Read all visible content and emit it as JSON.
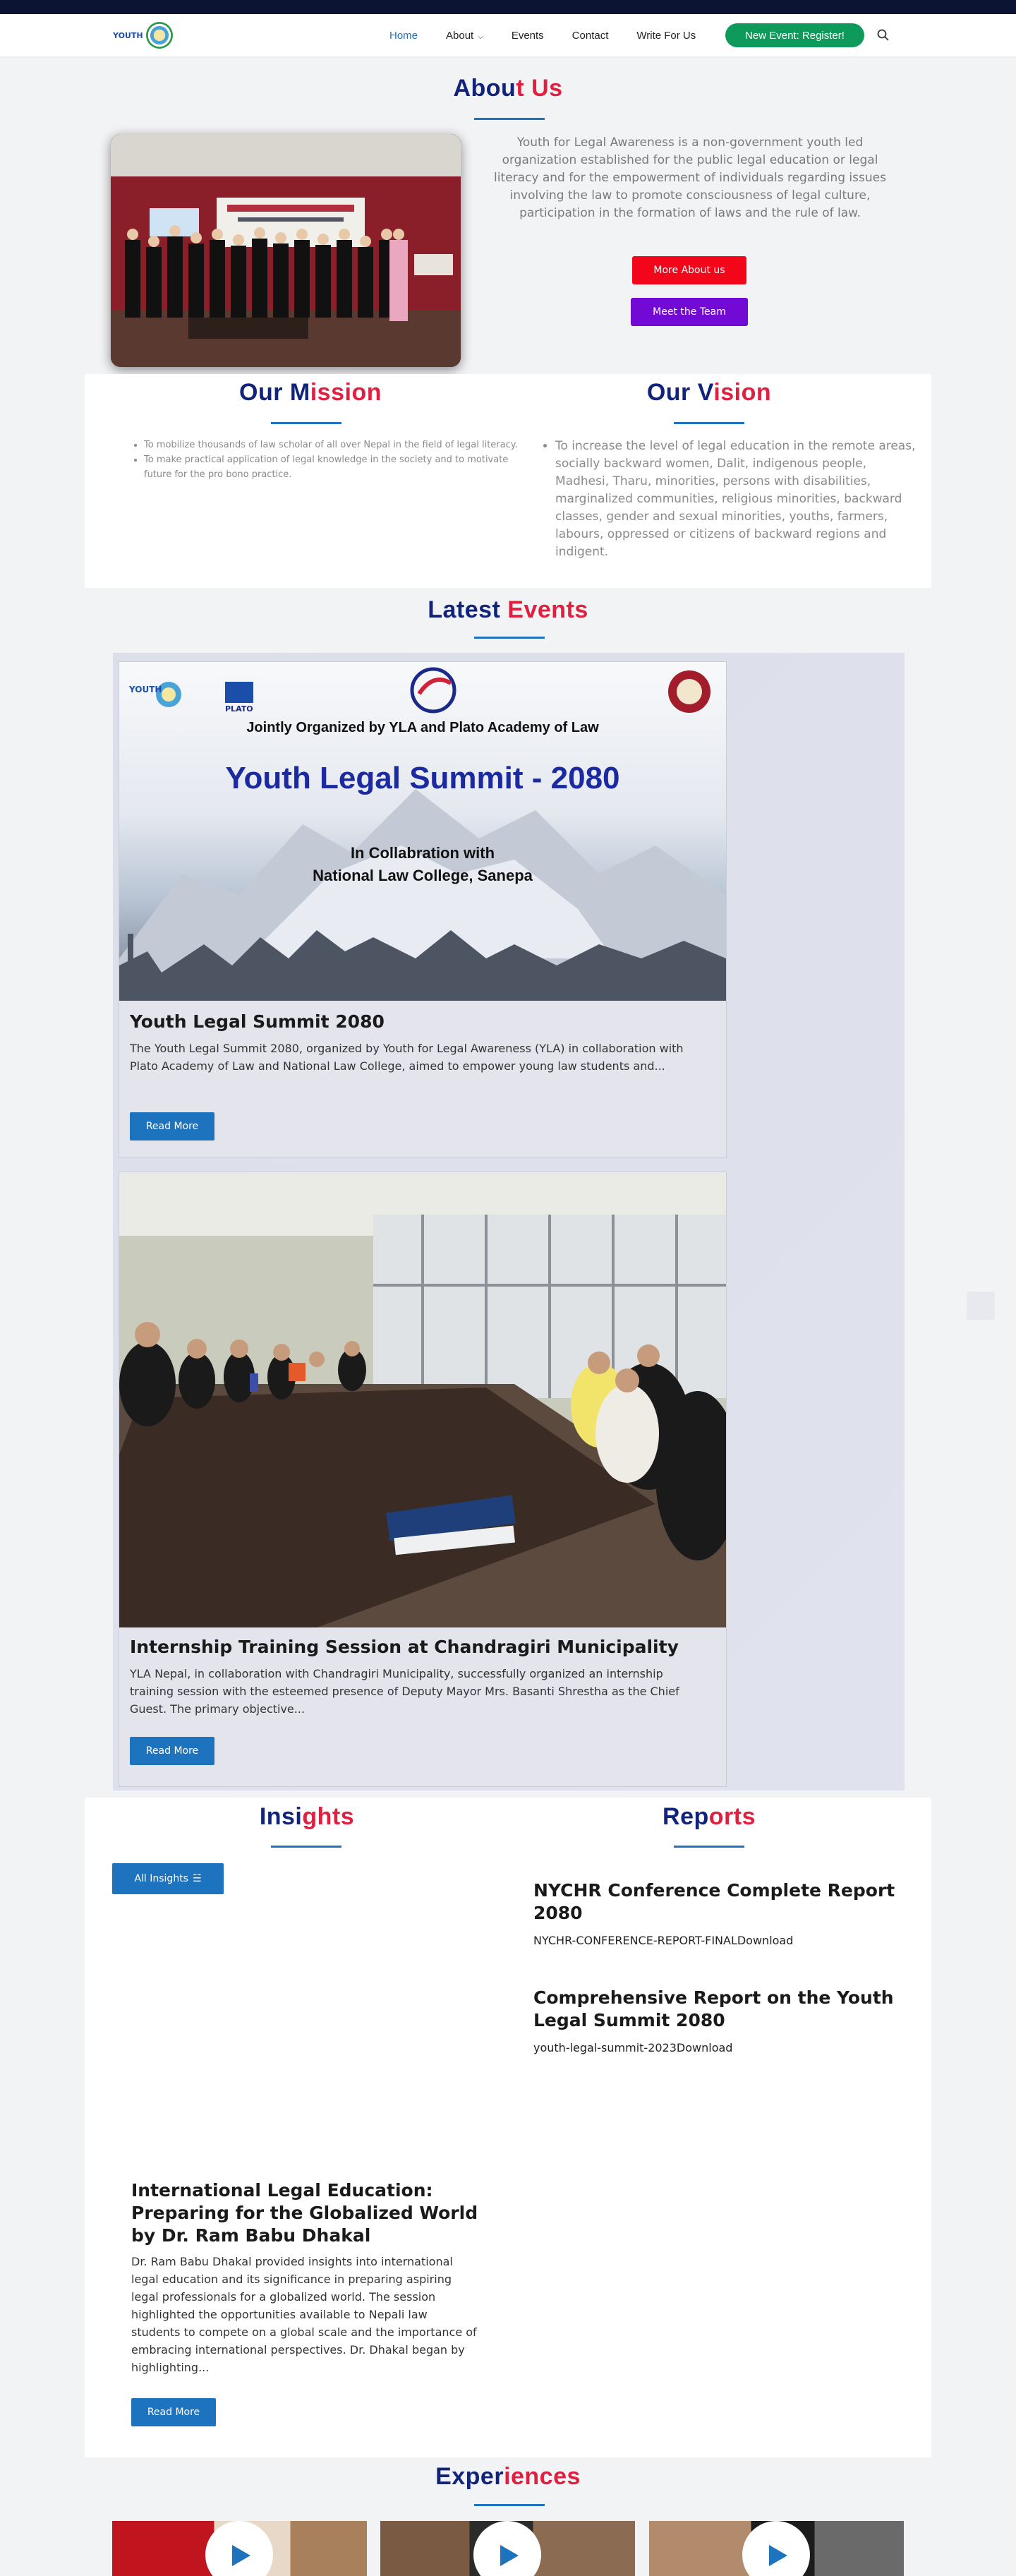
{
  "nav": {
    "logo_text": "YOUTH",
    "items": [
      {
        "label": "Home"
      },
      {
        "label": "About"
      },
      {
        "label": "Events"
      },
      {
        "label": "Contact"
      },
      {
        "label": "Write For Us"
      }
    ],
    "register_label": "New Event: Register!"
  },
  "about": {
    "title_a": "Abou",
    "title_b": "t Us",
    "text": "Youth for Legal Awareness is a non-government youth led organization established for the public legal education or legal literacy and for the empowerment of individuals regarding issues involving the law to promote consciousness of legal culture, participation in the formation of laws and the rule of law.",
    "more_label": "More About us",
    "team_label": "Meet the Team"
  },
  "mission": {
    "title_a": "Our M",
    "title_b": "ission",
    "items": [
      "To mobilize thousands of law scholar of all over Nepal in the field of legal literacy.",
      "To make practical application of legal knowledge in the society and to motivate future for the pro bono practice."
    ]
  },
  "vision": {
    "title_a": "Our V",
    "title_b": "ision",
    "items": [
      "To increase the level of legal education in the remote areas, socially backward women, Dalit, indigenous people, Madhesi, Tharu, minorities, persons with disabilities, marginalized communities, religious minorities, backward classes, gender and sexual minorities, youths, farmers, labours, oppressed or citizens of backward regions and indigent."
    ]
  },
  "events": {
    "title_a": "Latest ",
    "title_b": "Events",
    "poster": {
      "org_line": "Jointly Organized by YLA and Plato Academy of Law",
      "headline": "Youth Legal Summit - 2080",
      "collab_1": "In Collabration with",
      "collab_2": "National Law College, Sanepa",
      "logo_left": "YOUTH",
      "logo_plato": "PLATO"
    },
    "cards": [
      {
        "title": "Youth Legal Summit 2080",
        "excerpt": "The Youth Legal Summit 2080, organized by Youth for Legal Awareness (YLA) in collaboration with Plato Academy of Law and National Law College, aimed to empower young law students and...",
        "button": "Read More"
      },
      {
        "title": "Internship Training Session at Chandragiri Municipality",
        "excerpt": "YLA Nepal, in collaboration with Chandragiri Municipality, successfully organized an internship training session with the esteemed presence of Deputy Mayor Mrs. Basanti Shrestha as the Chief Guest. The primary objective...",
        "button": "Read More"
      }
    ]
  },
  "insights": {
    "title_a": "Insi",
    "title_b": "ghts",
    "all_label": "All Insights",
    "post": {
      "title": "International Legal Education: Preparing for the Globalized World by Dr. Ram Babu Dhakal",
      "excerpt": "Dr. Ram Babu Dhakal provided insights into international legal education and its significance in preparing aspiring legal professionals for a globalized world. The session highlighted the opportunities available to Nepali law students to compete on a global scale and the importance of embracing international perspectives. Dr. Dhakal began by highlighting...",
      "button": "Read More"
    }
  },
  "reports": {
    "title_a": "Rep",
    "title_b": "orts",
    "items": [
      {
        "title": "NYCHR Conference Complete Report 2080",
        "file": "NYCHR-CONFERENCE-REPORT-FINALDownload"
      },
      {
        "title": "Comprehensive Report on the Youth Legal Summit 2080",
        "file": "youth-legal-summit-2023Download"
      }
    ]
  },
  "experiences": {
    "title_a": "Exper",
    "title_b": "iences"
  },
  "colors": {
    "navy": "#12237a",
    "red": "#e02040",
    "blue": "#1e73be",
    "green": "#0e9a5b",
    "purple": "#7209d4"
  }
}
